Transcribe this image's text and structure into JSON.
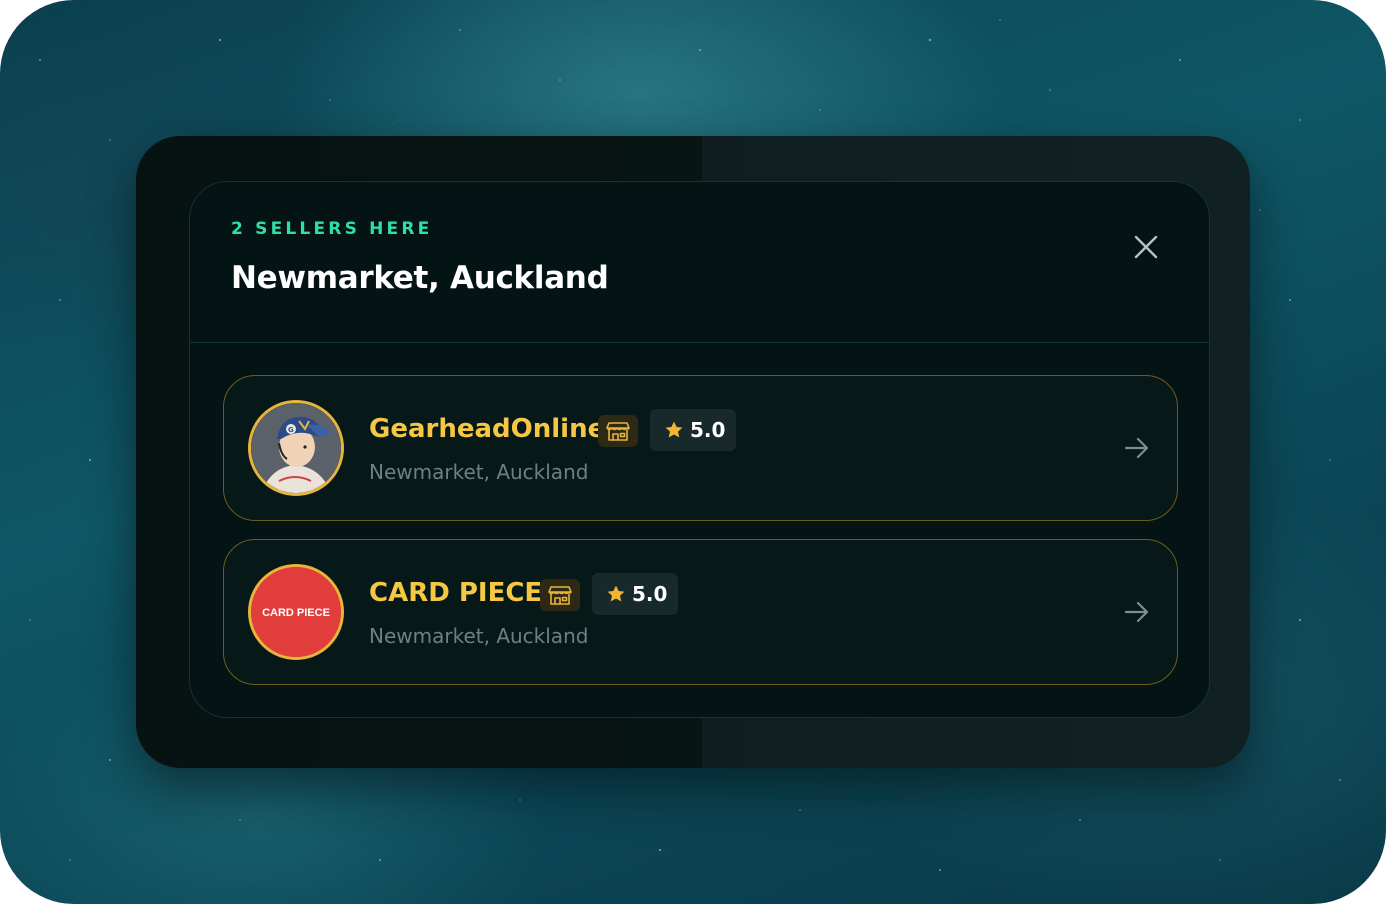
{
  "popup": {
    "eyebrow": "2 SELLERS HERE",
    "title": "Newmarket, Auckland",
    "close_icon": "close-icon"
  },
  "sellers": [
    {
      "name": "GearheadOnline",
      "location": "Newmarket, Auckland",
      "rating": "5.0",
      "avatar": "illustrated-avatar",
      "badge_icon": "storefront-icon",
      "arrow_icon": "arrow-right-icon"
    },
    {
      "name": "CARD PIECE",
      "location": "Newmarket, Auckland",
      "rating": "5.0",
      "avatar_text": "CARD PIECE",
      "badge_icon": "storefront-icon",
      "arrow_icon": "arrow-right-icon"
    }
  ],
  "colors": {
    "accent_green": "#2ee0a3",
    "seller_name_gold": "#f5c743",
    "card_border": "#6f5b20",
    "avatar_ring": "#e8b43a",
    "card_piece_red": "#e03d3b",
    "panel_bg": "#041314"
  }
}
